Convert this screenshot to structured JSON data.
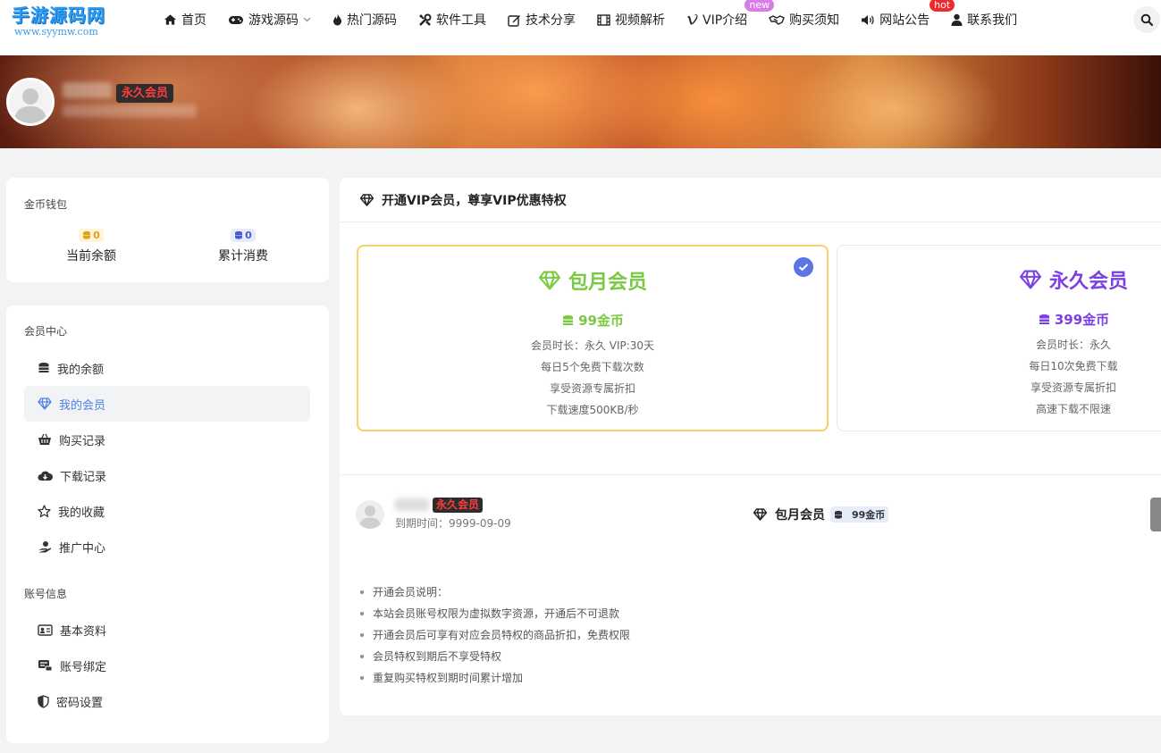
{
  "site": {
    "logo_main": "手游源码网",
    "logo_sub": "www.syymw.com"
  },
  "nav": [
    {
      "label": "首页",
      "icon": "home-icon"
    },
    {
      "label": "游戏源码",
      "icon": "gamepad-icon",
      "dropdown": true
    },
    {
      "label": "热门源码",
      "icon": "fire-icon"
    },
    {
      "label": "软件工具",
      "icon": "tools-icon"
    },
    {
      "label": "技术分享",
      "icon": "edit-icon"
    },
    {
      "label": "视频解析",
      "icon": "film-icon"
    },
    {
      "label": "VIP介绍",
      "icon": "vimeo-icon",
      "badge": "new"
    },
    {
      "label": "购买须知",
      "icon": "handshake-icon"
    },
    {
      "label": "网站公告",
      "icon": "volume-icon",
      "badge": "hot"
    },
    {
      "label": "联系我们",
      "icon": "user-icon"
    }
  ],
  "profile": {
    "vip_label": "永久会员"
  },
  "wallet": {
    "title": "金币钱包",
    "balance_value": "0",
    "balance_label": "当前余额",
    "spent_value": "0",
    "spent_label": "累计消费"
  },
  "menu": {
    "member_title": "会员中心",
    "member_items": [
      {
        "label": "我的余额",
        "icon": "coins-icon"
      },
      {
        "label": "我的会员",
        "icon": "diamond-icon",
        "active": true
      },
      {
        "label": "购买记录",
        "icon": "basket-icon"
      },
      {
        "label": "下载记录",
        "icon": "cloud-download-icon"
      },
      {
        "label": "我的收藏",
        "icon": "star-icon"
      },
      {
        "label": "推广中心",
        "icon": "hand-coin-icon"
      }
    ],
    "account_title": "账号信息",
    "account_items": [
      {
        "label": "基本资料",
        "icon": "id-card-icon"
      },
      {
        "label": "账号绑定",
        "icon": "link-card-icon"
      },
      {
        "label": "密码设置",
        "icon": "shield-icon"
      }
    ]
  },
  "main": {
    "title": "开通VIP会员，尊享VIP优惠特权",
    "plans": [
      {
        "name": "包月会员",
        "price": "99金币",
        "color": "#7ac943",
        "selected": true,
        "features": [
          "会员时长：永久 VIP:30天",
          "每日5个免费下载次数",
          "享受资源专属折扣",
          "下载速度500KB/秒"
        ]
      },
      {
        "name": "永久会员",
        "price": "399金币",
        "color": "#7b3fe4",
        "selected": false,
        "features": [
          "会员时长：永久",
          "每日10次免费下载",
          "享受资源专属折扣",
          "高速下载不限速"
        ]
      }
    ],
    "order": {
      "vip_label": "永久会员",
      "expire": "到期时间：9999-09-09",
      "plan_name": "包月会员",
      "plan_price": "99金币"
    },
    "notes": [
      "开通会员说明：",
      "本站会员账号权限为虚拟数字资源，开通后不可退款",
      "开通会员后可享有对应会员特权的商品折扣，免费权限",
      "会员特权到期后不享受特权",
      "重复购买特权到期时间累计增加"
    ]
  },
  "colors": {
    "accent": "#4f7fe8",
    "selected_border": "#f9cf6a",
    "vip_red": "#ff3b3b"
  }
}
